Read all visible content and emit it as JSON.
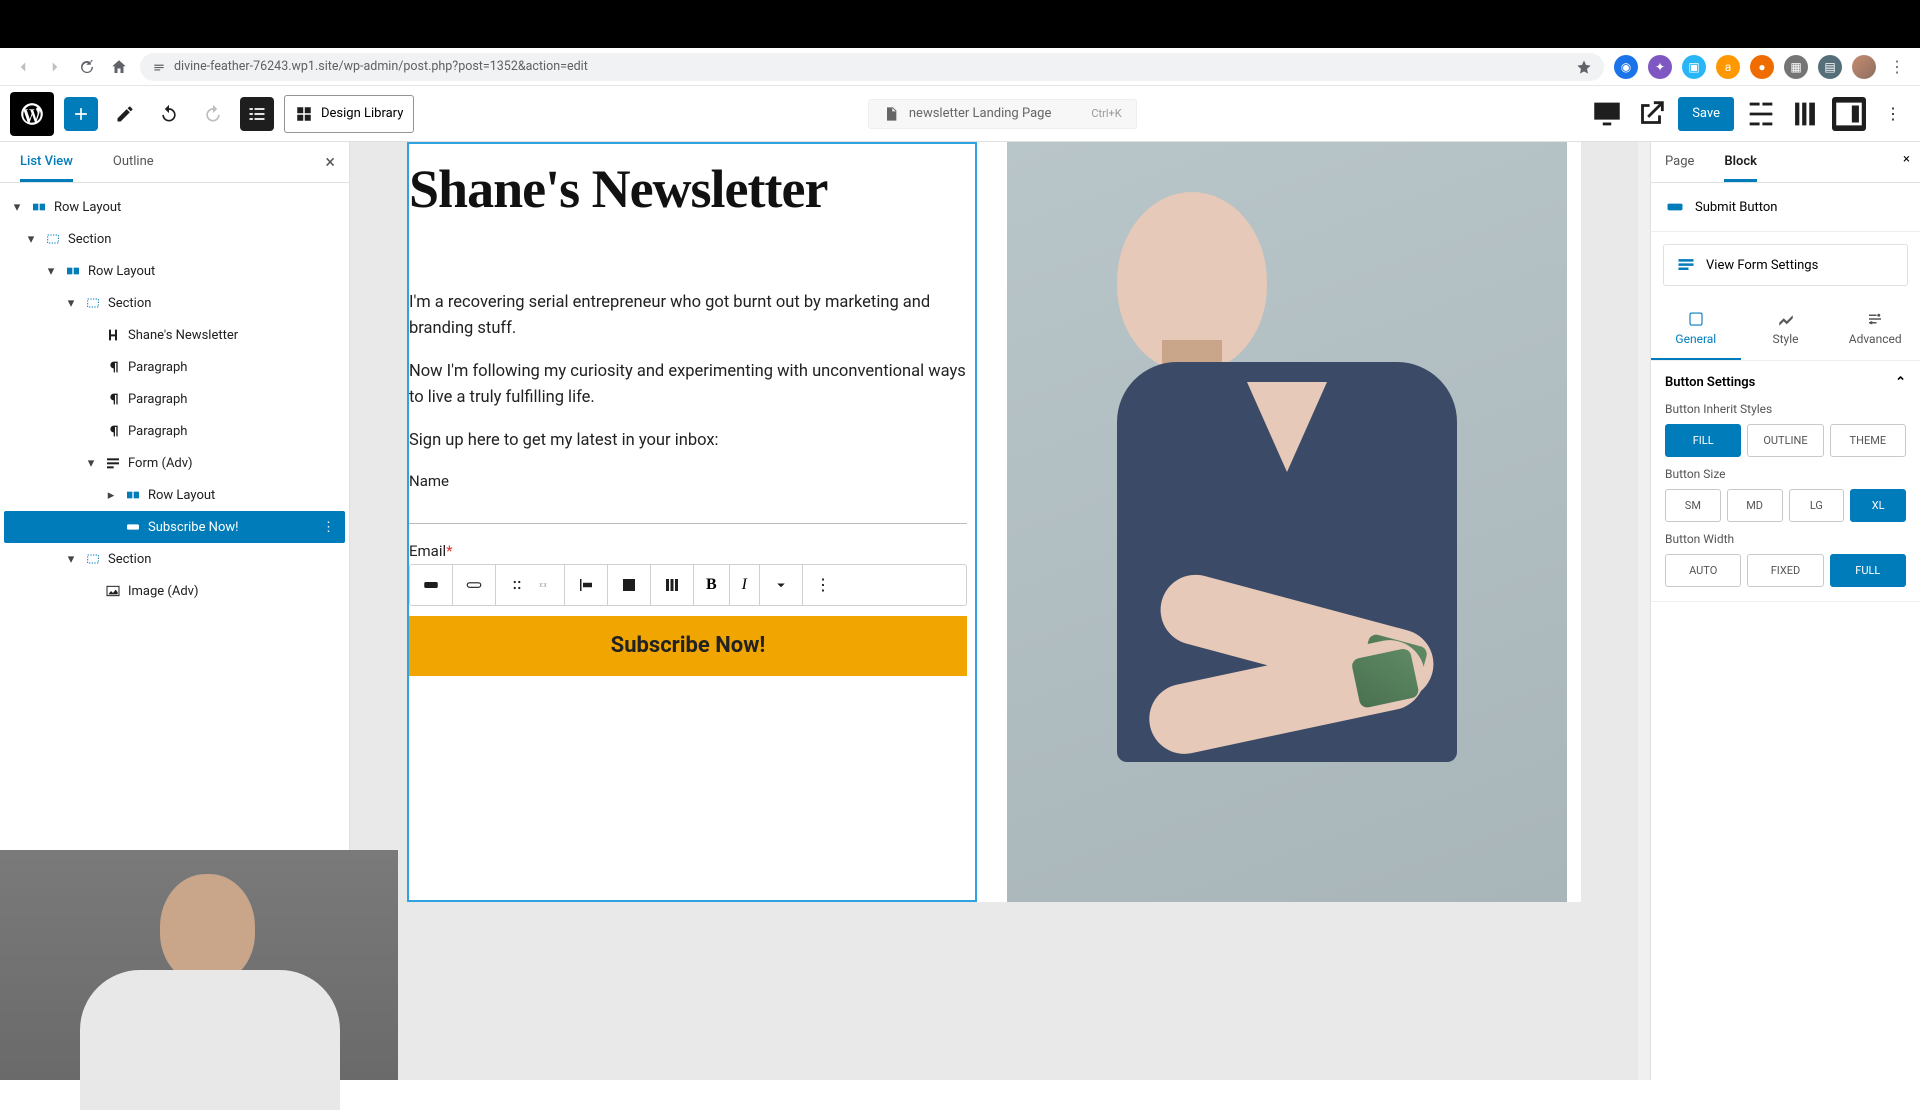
{
  "browser": {
    "url": "divine-feather-76243.wp1.site/wp-admin/post.php?post=1352&action=edit"
  },
  "topbar": {
    "design_library": "Design Library",
    "doc_title": "newsletter Landing Page",
    "shortcut": "Ctrl+K",
    "save": "Save"
  },
  "leftpanel": {
    "tabs": {
      "list": "List View",
      "outline": "Outline"
    },
    "tree": [
      {
        "label": "Row Layout",
        "indent": 0,
        "icon": "rowlayout",
        "chev": "▾"
      },
      {
        "label": "Section",
        "indent": 1,
        "icon": "section",
        "chev": "▾"
      },
      {
        "label": "Row Layout",
        "indent": 2,
        "icon": "rowlayout",
        "chev": "▾"
      },
      {
        "label": "Section",
        "indent": 3,
        "icon": "section",
        "chev": "▾"
      },
      {
        "label": "Shane's Newsletter",
        "indent": 4,
        "icon": "heading",
        "chev": ""
      },
      {
        "label": "Paragraph",
        "indent": 4,
        "icon": "para",
        "chev": ""
      },
      {
        "label": "Paragraph",
        "indent": 4,
        "icon": "para",
        "chev": ""
      },
      {
        "label": "Paragraph",
        "indent": 4,
        "icon": "para",
        "chev": ""
      },
      {
        "label": "Form (Adv)",
        "indent": 4,
        "icon": "form",
        "chev": "▾"
      },
      {
        "label": "Row Layout",
        "indent": 5,
        "icon": "rowlayout",
        "chev": "▸"
      },
      {
        "label": "Subscribe Now!",
        "indent": 5,
        "icon": "button",
        "chev": "",
        "selected": true
      },
      {
        "label": "Section",
        "indent": 3,
        "icon": "section",
        "chev": "▾"
      },
      {
        "label": "Image (Adv)",
        "indent": 4,
        "icon": "image",
        "chev": ""
      }
    ]
  },
  "content": {
    "heading": "Shane's Newsletter",
    "p1": "I'm a recovering serial entrepreneur who got burnt out by marketing and branding stuff.",
    "p2": "Now I'm following my curiosity and experimenting with unconventional ways to live a truly fulfilling life.",
    "p3": "Sign up here to get my latest in your inbox:",
    "name_label": "Name",
    "email_label": "Email",
    "required": "*",
    "button": "Subscribe Now!"
  },
  "rightpanel": {
    "tabs": {
      "page": "Page",
      "block": "Block"
    },
    "block_name": "Submit Button",
    "view_form": "View Form Settings",
    "modes": {
      "general": "General",
      "style": "Style",
      "advanced": "Advanced"
    },
    "group1": "Button Settings",
    "inherit_label": "Button Inherit Styles",
    "inherit": [
      "FILL",
      "OUTLINE",
      "THEME"
    ],
    "size_label": "Button Size",
    "sizes": [
      "SM",
      "MD",
      "LG",
      "XL"
    ],
    "width_label": "Button Width",
    "widths": [
      "AUTO",
      "FIXED",
      "FULL"
    ]
  }
}
